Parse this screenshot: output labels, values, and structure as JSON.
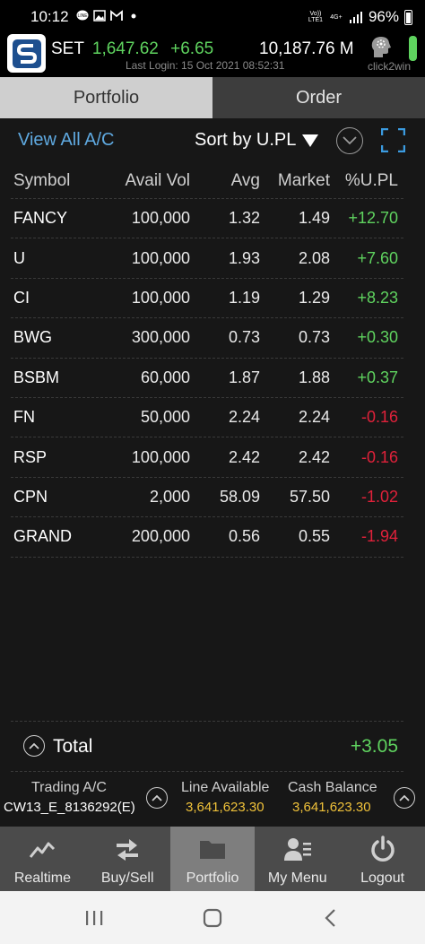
{
  "status_bar": {
    "time": "10:12",
    "volte": "Vo)) LTE1",
    "network": "4G+",
    "battery": "96%"
  },
  "header": {
    "market_label": "SET",
    "market_index": "1,647.62",
    "market_change": "+6.65",
    "market_value": "10,187.76 M",
    "last_login": "Last Login: 15 Oct 2021 08:52:31",
    "brand_label": "click2win"
  },
  "tabs": [
    {
      "label": "Portfolio",
      "active": true
    },
    {
      "label": "Order",
      "active": false
    }
  ],
  "toolbar": {
    "view_all": "View All A/C",
    "sort_label": "Sort by U.PL"
  },
  "table": {
    "headers": [
      "Symbol",
      "Avail Vol",
      "Avg",
      "Market",
      "%U.PL"
    ],
    "rows": [
      {
        "symbol": "FANCY",
        "avail_vol": "100,000",
        "avg": "1.32",
        "market": "1.49",
        "upl": "+12.70",
        "dir": "pos"
      },
      {
        "symbol": "U",
        "avail_vol": "100,000",
        "avg": "1.93",
        "market": "2.08",
        "upl": "+7.60",
        "dir": "pos"
      },
      {
        "symbol": "CI",
        "avail_vol": "100,000",
        "avg": "1.19",
        "market": "1.29",
        "upl": "+8.23",
        "dir": "pos"
      },
      {
        "symbol": "BWG",
        "avail_vol": "300,000",
        "avg": "0.73",
        "market": "0.73",
        "upl": "+0.30",
        "dir": "pos"
      },
      {
        "symbol": "BSBM",
        "avail_vol": "60,000",
        "avg": "1.87",
        "market": "1.88",
        "upl": "+0.37",
        "dir": "pos"
      },
      {
        "symbol": "FN",
        "avail_vol": "50,000",
        "avg": "2.24",
        "market": "2.24",
        "upl": "-0.16",
        "dir": "neg"
      },
      {
        "symbol": "RSP",
        "avail_vol": "100,000",
        "avg": "2.42",
        "market": "2.42",
        "upl": "-0.16",
        "dir": "neg"
      },
      {
        "symbol": "CPN",
        "avail_vol": "2,000",
        "avg": "58.09",
        "market": "57.50",
        "upl": "-1.02",
        "dir": "neg"
      },
      {
        "symbol": "GRAND",
        "avail_vol": "200,000",
        "avg": "0.56",
        "market": "0.55",
        "upl": "-1.94",
        "dir": "neg"
      }
    ]
  },
  "total": {
    "label": "Total",
    "value": "+3.05"
  },
  "account": {
    "trading_label": "Trading A/C",
    "trading_value": "CW13_E_8136292(E)",
    "line_label": "Line Available",
    "line_value": "3,641,623.30",
    "cash_label": "Cash Balance",
    "cash_value": "3,641,623.30"
  },
  "bottom_nav": [
    {
      "label": "Realtime",
      "icon": "chart-line-icon"
    },
    {
      "label": "Buy/Sell",
      "icon": "swap-arrows-icon"
    },
    {
      "label": "Portfolio",
      "icon": "folder-icon",
      "active": true
    },
    {
      "label": "My Menu",
      "icon": "user-list-icon"
    },
    {
      "label": "Logout",
      "icon": "power-icon"
    }
  ],
  "colors": {
    "positive": "#5fd35f",
    "negative": "#e0213a",
    "link": "#5fa9e0",
    "accent_yellow": "#f0c23a"
  }
}
